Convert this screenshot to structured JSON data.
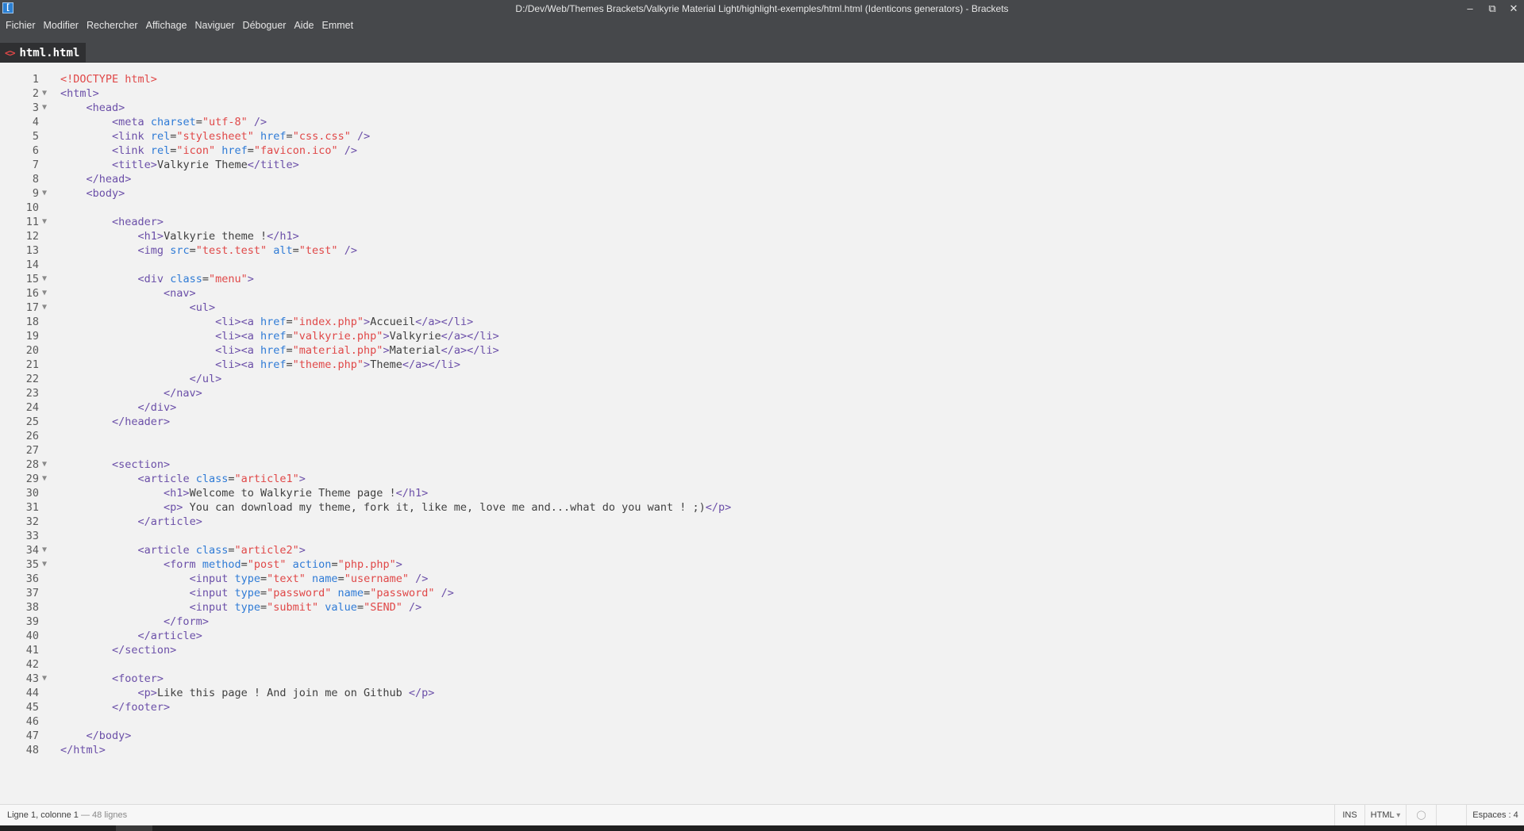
{
  "window": {
    "title": "D:/Dev/Web/Themes Brackets/Valkyrie Material Light/highlight-exemples/html.html (Identicons generators) - Brackets",
    "minimize": "–",
    "restore": "⧉",
    "close": "✕"
  },
  "menu": [
    "Fichier",
    "Modifier",
    "Rechercher",
    "Affichage",
    "Naviguer",
    "Déboguer",
    "Aide",
    "Emmet"
  ],
  "tab": {
    "icon": "<>",
    "label": "html.html"
  },
  "code_lines": [
    {
      "n": "1",
      "fold": "",
      "tokens": [
        [
          "dt",
          "<!DOCTYPE html>"
        ]
      ]
    },
    {
      "n": "2",
      "fold": "▼",
      "tokens": [
        [
          "tg",
          "<html>"
        ]
      ]
    },
    {
      "n": "3",
      "fold": "▼",
      "tokens": [
        [
          "tx",
          "    "
        ],
        [
          "tg",
          "<head>"
        ]
      ]
    },
    {
      "n": "4",
      "fold": "",
      "tokens": [
        [
          "tx",
          "        "
        ],
        [
          "tg",
          "<meta "
        ],
        [
          "at",
          "charset"
        ],
        [
          "tx",
          "="
        ],
        [
          "st",
          "\"utf-8\""
        ],
        [
          "tg",
          " />"
        ]
      ]
    },
    {
      "n": "5",
      "fold": "",
      "tokens": [
        [
          "tx",
          "        "
        ],
        [
          "tg",
          "<link "
        ],
        [
          "at",
          "rel"
        ],
        [
          "tx",
          "="
        ],
        [
          "st",
          "\"stylesheet\""
        ],
        [
          "tx",
          " "
        ],
        [
          "at",
          "href"
        ],
        [
          "tx",
          "="
        ],
        [
          "st",
          "\"css.css\""
        ],
        [
          "tg",
          " />"
        ]
      ]
    },
    {
      "n": "6",
      "fold": "",
      "tokens": [
        [
          "tx",
          "        "
        ],
        [
          "tg",
          "<link "
        ],
        [
          "at",
          "rel"
        ],
        [
          "tx",
          "="
        ],
        [
          "st",
          "\"icon\""
        ],
        [
          "tx",
          " "
        ],
        [
          "at",
          "href"
        ],
        [
          "tx",
          "="
        ],
        [
          "st",
          "\"favicon.ico\""
        ],
        [
          "tg",
          " />"
        ]
      ]
    },
    {
      "n": "7",
      "fold": "",
      "tokens": [
        [
          "tx",
          "        "
        ],
        [
          "tg",
          "<title>"
        ],
        [
          "tx",
          "Valkyrie Theme"
        ],
        [
          "tg",
          "</title>"
        ]
      ]
    },
    {
      "n": "8",
      "fold": "",
      "tokens": [
        [
          "tx",
          "    "
        ],
        [
          "tg",
          "</head>"
        ]
      ]
    },
    {
      "n": "9",
      "fold": "▼",
      "tokens": [
        [
          "tx",
          "    "
        ],
        [
          "tg",
          "<body>"
        ]
      ]
    },
    {
      "n": "10",
      "fold": "",
      "tokens": []
    },
    {
      "n": "11",
      "fold": "▼",
      "tokens": [
        [
          "tx",
          "        "
        ],
        [
          "tg",
          "<header>"
        ]
      ]
    },
    {
      "n": "12",
      "fold": "",
      "tokens": [
        [
          "tx",
          "            "
        ],
        [
          "tg",
          "<h1>"
        ],
        [
          "tx",
          "Valkyrie theme !"
        ],
        [
          "tg",
          "</h1>"
        ]
      ]
    },
    {
      "n": "13",
      "fold": "",
      "tokens": [
        [
          "tx",
          "            "
        ],
        [
          "tg",
          "<img "
        ],
        [
          "at",
          "src"
        ],
        [
          "tx",
          "="
        ],
        [
          "st",
          "\"test.test\""
        ],
        [
          "tx",
          " "
        ],
        [
          "at",
          "alt"
        ],
        [
          "tx",
          "="
        ],
        [
          "st",
          "\"test\""
        ],
        [
          "tg",
          " />"
        ]
      ]
    },
    {
      "n": "14",
      "fold": "",
      "tokens": []
    },
    {
      "n": "15",
      "fold": "▼",
      "tokens": [
        [
          "tx",
          "            "
        ],
        [
          "tg",
          "<div "
        ],
        [
          "at",
          "class"
        ],
        [
          "tx",
          "="
        ],
        [
          "st",
          "\"menu\""
        ],
        [
          "tg",
          ">"
        ]
      ]
    },
    {
      "n": "16",
      "fold": "▼",
      "tokens": [
        [
          "tx",
          "                "
        ],
        [
          "tg",
          "<nav>"
        ]
      ]
    },
    {
      "n": "17",
      "fold": "▼",
      "tokens": [
        [
          "tx",
          "                    "
        ],
        [
          "tg",
          "<ul>"
        ]
      ]
    },
    {
      "n": "18",
      "fold": "",
      "tokens": [
        [
          "tx",
          "                        "
        ],
        [
          "tg",
          "<li><a "
        ],
        [
          "at",
          "href"
        ],
        [
          "tx",
          "="
        ],
        [
          "st",
          "\"index.php\""
        ],
        [
          "tg",
          ">"
        ],
        [
          "tx",
          "Accueil"
        ],
        [
          "tg",
          "</a></li>"
        ]
      ]
    },
    {
      "n": "19",
      "fold": "",
      "tokens": [
        [
          "tx",
          "                        "
        ],
        [
          "tg",
          "<li><a "
        ],
        [
          "at",
          "href"
        ],
        [
          "tx",
          "="
        ],
        [
          "st",
          "\"valkyrie.php\""
        ],
        [
          "tg",
          ">"
        ],
        [
          "tx",
          "Valkyrie"
        ],
        [
          "tg",
          "</a></li>"
        ]
      ]
    },
    {
      "n": "20",
      "fold": "",
      "tokens": [
        [
          "tx",
          "                        "
        ],
        [
          "tg",
          "<li><a "
        ],
        [
          "at",
          "href"
        ],
        [
          "tx",
          "="
        ],
        [
          "st",
          "\"material.php\""
        ],
        [
          "tg",
          ">"
        ],
        [
          "tx",
          "Material"
        ],
        [
          "tg",
          "</a></li>"
        ]
      ]
    },
    {
      "n": "21",
      "fold": "",
      "tokens": [
        [
          "tx",
          "                        "
        ],
        [
          "tg",
          "<li><a "
        ],
        [
          "at",
          "href"
        ],
        [
          "tx",
          "="
        ],
        [
          "st",
          "\"theme.php\""
        ],
        [
          "tg",
          ">"
        ],
        [
          "tx",
          "Theme"
        ],
        [
          "tg",
          "</a></li>"
        ]
      ]
    },
    {
      "n": "22",
      "fold": "",
      "tokens": [
        [
          "tx",
          "                    "
        ],
        [
          "tg",
          "</ul>"
        ]
      ]
    },
    {
      "n": "23",
      "fold": "",
      "tokens": [
        [
          "tx",
          "                "
        ],
        [
          "tg",
          "</nav>"
        ]
      ]
    },
    {
      "n": "24",
      "fold": "",
      "tokens": [
        [
          "tx",
          "            "
        ],
        [
          "tg",
          "</div>"
        ]
      ]
    },
    {
      "n": "25",
      "fold": "",
      "tokens": [
        [
          "tx",
          "        "
        ],
        [
          "tg",
          "</header>"
        ]
      ]
    },
    {
      "n": "26",
      "fold": "",
      "tokens": []
    },
    {
      "n": "27",
      "fold": "",
      "tokens": []
    },
    {
      "n": "28",
      "fold": "▼",
      "tokens": [
        [
          "tx",
          "        "
        ],
        [
          "tg",
          "<section>"
        ]
      ]
    },
    {
      "n": "29",
      "fold": "▼",
      "tokens": [
        [
          "tx",
          "            "
        ],
        [
          "tg",
          "<article "
        ],
        [
          "at",
          "class"
        ],
        [
          "tx",
          "="
        ],
        [
          "st",
          "\"article1\""
        ],
        [
          "tg",
          ">"
        ]
      ]
    },
    {
      "n": "30",
      "fold": "",
      "tokens": [
        [
          "tx",
          "                "
        ],
        [
          "tg",
          "<h1>"
        ],
        [
          "tx",
          "Welcome to Walkyrie Theme page !"
        ],
        [
          "tg",
          "</h1>"
        ]
      ]
    },
    {
      "n": "31",
      "fold": "",
      "tokens": [
        [
          "tx",
          "                "
        ],
        [
          "tg",
          "<p>"
        ],
        [
          "tx",
          " You can download my theme, fork it, like me, love me and...what do you want ! ;)"
        ],
        [
          "tg",
          "</p>"
        ]
      ]
    },
    {
      "n": "32",
      "fold": "",
      "tokens": [
        [
          "tx",
          "            "
        ],
        [
          "tg",
          "</article>"
        ]
      ]
    },
    {
      "n": "33",
      "fold": "",
      "tokens": []
    },
    {
      "n": "34",
      "fold": "▼",
      "tokens": [
        [
          "tx",
          "            "
        ],
        [
          "tg",
          "<article "
        ],
        [
          "at",
          "class"
        ],
        [
          "tx",
          "="
        ],
        [
          "st",
          "\"article2\""
        ],
        [
          "tg",
          ">"
        ]
      ]
    },
    {
      "n": "35",
      "fold": "▼",
      "tokens": [
        [
          "tx",
          "                "
        ],
        [
          "tg",
          "<form "
        ],
        [
          "at",
          "method"
        ],
        [
          "tx",
          "="
        ],
        [
          "st",
          "\"post\""
        ],
        [
          "tx",
          " "
        ],
        [
          "at",
          "action"
        ],
        [
          "tx",
          "="
        ],
        [
          "st",
          "\"php.php\""
        ],
        [
          "tg",
          ">"
        ]
      ]
    },
    {
      "n": "36",
      "fold": "",
      "tokens": [
        [
          "tx",
          "                    "
        ],
        [
          "tg",
          "<input "
        ],
        [
          "at",
          "type"
        ],
        [
          "tx",
          "="
        ],
        [
          "st",
          "\"text\""
        ],
        [
          "tx",
          " "
        ],
        [
          "at",
          "name"
        ],
        [
          "tx",
          "="
        ],
        [
          "st",
          "\"username\""
        ],
        [
          "tg",
          " />"
        ]
      ]
    },
    {
      "n": "37",
      "fold": "",
      "tokens": [
        [
          "tx",
          "                    "
        ],
        [
          "tg",
          "<input "
        ],
        [
          "at",
          "type"
        ],
        [
          "tx",
          "="
        ],
        [
          "st",
          "\"password\""
        ],
        [
          "tx",
          " "
        ],
        [
          "at",
          "name"
        ],
        [
          "tx",
          "="
        ],
        [
          "st",
          "\"password\""
        ],
        [
          "tg",
          " />"
        ]
      ]
    },
    {
      "n": "38",
      "fold": "",
      "tokens": [
        [
          "tx",
          "                    "
        ],
        [
          "tg",
          "<input "
        ],
        [
          "at",
          "type"
        ],
        [
          "tx",
          "="
        ],
        [
          "st",
          "\"submit\""
        ],
        [
          "tx",
          " "
        ],
        [
          "at",
          "value"
        ],
        [
          "tx",
          "="
        ],
        [
          "st",
          "\"SEND\""
        ],
        [
          "tg",
          " />"
        ]
      ]
    },
    {
      "n": "39",
      "fold": "",
      "tokens": [
        [
          "tx",
          "                "
        ],
        [
          "tg",
          "</form>"
        ]
      ]
    },
    {
      "n": "40",
      "fold": "",
      "tokens": [
        [
          "tx",
          "            "
        ],
        [
          "tg",
          "</article>"
        ]
      ]
    },
    {
      "n": "41",
      "fold": "",
      "tokens": [
        [
          "tx",
          "        "
        ],
        [
          "tg",
          "</section>"
        ]
      ]
    },
    {
      "n": "42",
      "fold": "",
      "tokens": []
    },
    {
      "n": "43",
      "fold": "▼",
      "tokens": [
        [
          "tx",
          "        "
        ],
        [
          "tg",
          "<footer>"
        ]
      ]
    },
    {
      "n": "44",
      "fold": "",
      "tokens": [
        [
          "tx",
          "            "
        ],
        [
          "tg",
          "<p>"
        ],
        [
          "tx",
          "Like this page ! And join me on Github "
        ],
        [
          "tg",
          "</p>"
        ]
      ]
    },
    {
      "n": "45",
      "fold": "",
      "tokens": [
        [
          "tx",
          "        "
        ],
        [
          "tg",
          "</footer>"
        ]
      ]
    },
    {
      "n": "46",
      "fold": "",
      "tokens": []
    },
    {
      "n": "47",
      "fold": "",
      "tokens": [
        [
          "tx",
          "    "
        ],
        [
          "tg",
          "</body>"
        ]
      ]
    },
    {
      "n": "48",
      "fold": "",
      "tokens": [
        [
          "tg",
          "</html>"
        ]
      ]
    }
  ],
  "status": {
    "cursor": "Ligne 1, colonne 1",
    "lines": " — 48 lignes",
    "ins": "INS",
    "language": "HTML",
    "language_caret": "▾",
    "lint_icon": "◯",
    "spaces": "Espaces : 4"
  },
  "colors": {
    "chrome": "#46484b",
    "editor_bg": "#f2f2f2",
    "tag": "#6b4fa8",
    "attribute": "#2f7bd6",
    "string": "#e04848"
  }
}
